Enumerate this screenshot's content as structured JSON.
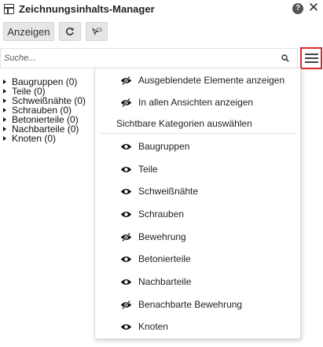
{
  "header": {
    "title": "Zeichnungsinhalts-Manager",
    "help_symbol": "?",
    "close_symbol": "✕"
  },
  "toolbar": {
    "show_label": "Anzeigen",
    "refresh_icon": "refresh-icon",
    "select_icon": "select-objects-icon"
  },
  "search": {
    "placeholder": "Suche..."
  },
  "tree": {
    "items": [
      {
        "label": "Baugruppen (0)"
      },
      {
        "label": "Teile (0)"
      },
      {
        "label": "Schweißnähte (0)"
      },
      {
        "label": "Schrauben (0)"
      },
      {
        "label": "Betonierteile (0)"
      },
      {
        "label": "Nachbarteile (0)"
      },
      {
        "label": "Knoten (0)"
      }
    ]
  },
  "dropdown": {
    "options": [
      {
        "label": "Ausgeblendete Elemente anzeigen",
        "icon": "eye-crossed-icon"
      },
      {
        "label": "In allen Ansichten anzeigen",
        "icon": "eye-crossed-icon"
      }
    ],
    "section_label": "Sichtbare Kategorien auswählen",
    "categories": [
      {
        "label": "Baugruppen",
        "icon": "eye-icon"
      },
      {
        "label": "Teile",
        "icon": "eye-icon"
      },
      {
        "label": "Schweißnähte",
        "icon": "eye-icon"
      },
      {
        "label": "Schrauben",
        "icon": "eye-icon"
      },
      {
        "label": "Bewehrung",
        "icon": "eye-crossed-icon"
      },
      {
        "label": "Betonierteile",
        "icon": "eye-icon"
      },
      {
        "label": "Nachbarteile",
        "icon": "eye-icon"
      },
      {
        "label": "Benachbarte Bewehrung",
        "icon": "eye-crossed-icon"
      },
      {
        "label": "Knoten",
        "icon": "eye-icon"
      }
    ]
  },
  "colors": {
    "menu_highlight": "#d42a2a",
    "button_bg": "#e6e6e6"
  }
}
